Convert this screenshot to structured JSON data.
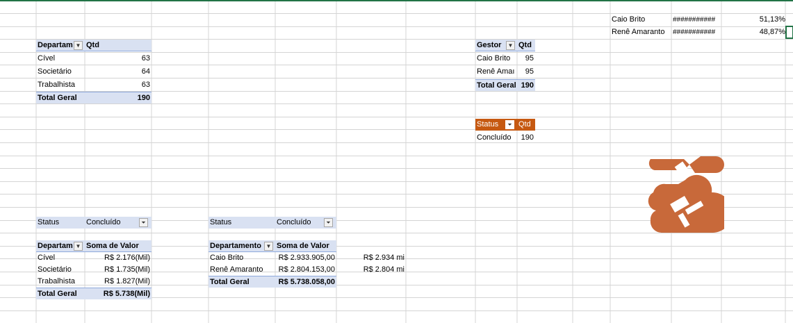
{
  "ranking": {
    "rows": [
      {
        "name": "Caio Brito",
        "bar": "###########",
        "pct": "51,13%"
      },
      {
        "name": "Renê Amaranto",
        "bar": "###########",
        "pct": "48,87%"
      }
    ]
  },
  "pivot_dept": {
    "headers": [
      "Departam",
      "Qtd"
    ],
    "rows": [
      {
        "label": "Cível",
        "value": "63"
      },
      {
        "label": "Societário",
        "value": "64"
      },
      {
        "label": "Trabalhista",
        "value": "63"
      }
    ],
    "total": {
      "label": "Total Geral",
      "value": "190"
    }
  },
  "pivot_gestor": {
    "headers": [
      "Gestor",
      "Qtd"
    ],
    "rows": [
      {
        "label": "Caio Brito",
        "value": "95"
      },
      {
        "label": "Renê Amaı",
        "value": "95"
      }
    ],
    "total": {
      "label": "Total Geral",
      "value": "190"
    }
  },
  "pivot_status": {
    "headers": [
      "Status",
      "Qtd"
    ],
    "rows": [
      {
        "label": "Concluído",
        "value": "190"
      }
    ],
    "header_color": "#c65911"
  },
  "pivot_dept_valor": {
    "filter": {
      "label": "Status",
      "value": "Concluído"
    },
    "headers": [
      "Departam",
      "Soma de Valor"
    ],
    "rows": [
      {
        "label": "Cível",
        "value": "R$ 2.176(Mil)"
      },
      {
        "label": "Societário",
        "value": "R$ 1.735(Mil)"
      },
      {
        "label": "Trabalhista",
        "value": "R$ 1.827(Mil)"
      }
    ],
    "total": {
      "label": "Total Geral",
      "value": "R$ 5.738(Mil)"
    }
  },
  "pivot_gestor_valor": {
    "filter": {
      "label": "Status",
      "value": "Concluído"
    },
    "headers": [
      "Departamento",
      "Soma de Valor"
    ],
    "rows": [
      {
        "label": "Caio Brito",
        "value": "R$ 2.933.905,00",
        "extra": "R$ 2.934 mi"
      },
      {
        "label": "Renê Amaranto",
        "value": "R$ 2.804.153,00",
        "extra": "R$ 2.804 mi"
      }
    ],
    "total": {
      "label": "Total Geral",
      "value": "R$ 5.738.058,00"
    }
  },
  "colors": {
    "pivot_header": "#d9e1f2",
    "accent_orange": "#c65911",
    "logo_orange": "#c8693a",
    "gridline": "#d4d4d4",
    "selection": "#217346"
  },
  "logo": {
    "icon": "gavel-logo-icon"
  }
}
